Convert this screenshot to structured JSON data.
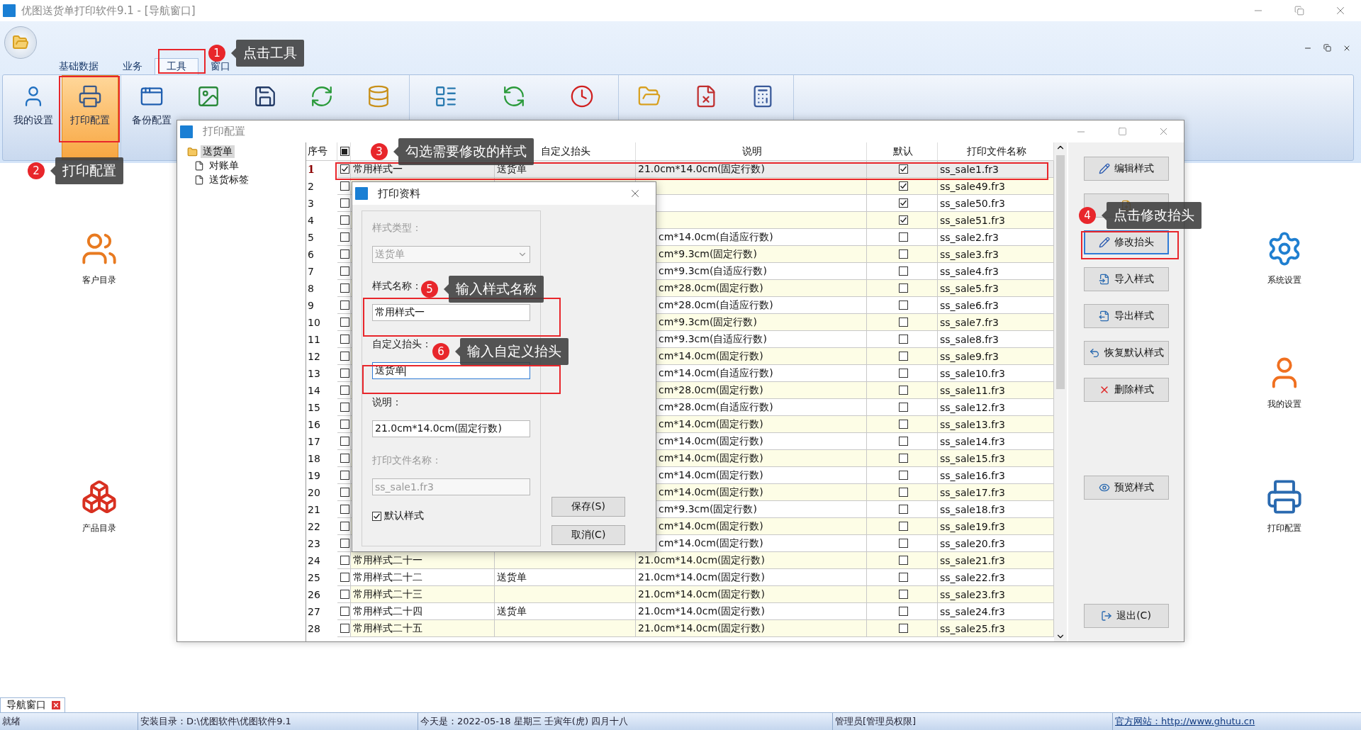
{
  "window": {
    "title": "优图送货单打印软件9.1 - [导航窗口]"
  },
  "ribbon": {
    "tabs": [
      {
        "label": "基础数据",
        "selected": false
      },
      {
        "label": "业务",
        "selected": false
      },
      {
        "label": "工具",
        "selected": true
      },
      {
        "label": "窗口",
        "selected": false
      }
    ],
    "toolbar_groups": [
      {
        "items": [
          {
            "label": "我的设置",
            "selected": false
          },
          {
            "label": "打印配置",
            "selected": true
          }
        ]
      },
      {
        "items": [
          {
            "label": "备份配置",
            "selected": false
          },
          {
            "selected": false
          },
          {
            "selected": false
          },
          {
            "selected": false
          },
          {
            "selected": false
          }
        ]
      },
      {
        "items": [
          {
            "selected": false
          },
          {
            "selected": false
          },
          {
            "selected": false
          }
        ]
      },
      {
        "items": [
          {
            "selected": false
          },
          {
            "selected": false
          },
          {
            "selected": false
          }
        ]
      }
    ]
  },
  "desktop_icons": [
    {
      "label": "客户目录"
    },
    {
      "label": "产品目录"
    },
    {
      "label": "系统设置"
    },
    {
      "label": "我的设置"
    },
    {
      "label": "打印配置"
    }
  ],
  "print_config": {
    "title": "打印配置",
    "tree": [
      {
        "label": "送货单",
        "selected": true,
        "kind": "folder"
      },
      {
        "label": "对账单",
        "selected": false,
        "kind": "document"
      },
      {
        "label": "送货标签",
        "selected": false,
        "kind": "document"
      }
    ],
    "table": {
      "header": {
        "number": "序号",
        "select_all_mixed": true,
        "custom_title": "自定义抬头",
        "description": "说明",
        "default": "默认",
        "file_name": "打印文件名称"
      },
      "rows": [
        {
          "no": "1",
          "checked": true,
          "selected": true,
          "covered": false,
          "name": "常用样式一",
          "custom_title": "送货单",
          "description": "21.0cm*14.0cm(固定行数)",
          "default": true,
          "file_name": "ss_sale1.fr3"
        },
        {
          "no": "2",
          "checked": false,
          "selected": false,
          "covered": true,
          "default": true,
          "file_name": "ss_sale49.fr3"
        },
        {
          "no": "3",
          "checked": false,
          "selected": false,
          "covered": true,
          "default": true,
          "file_name": "ss_sale50.fr3"
        },
        {
          "no": "4",
          "checked": false,
          "selected": false,
          "covered": true,
          "default": true,
          "file_name": "ss_sale51.fr3"
        },
        {
          "no": "5",
          "checked": false,
          "selected": false,
          "covered": true,
          "description": "cm*14.0cm(自适应行数)",
          "default": false,
          "file_name": "ss_sale2.fr3"
        },
        {
          "no": "6",
          "checked": false,
          "selected": false,
          "covered": true,
          "description": "cm*9.3cm(固定行数)",
          "default": false,
          "file_name": "ss_sale3.fr3"
        },
        {
          "no": "7",
          "checked": false,
          "selected": false,
          "covered": true,
          "description": "cm*9.3cm(自适应行数)",
          "default": false,
          "file_name": "ss_sale4.fr3"
        },
        {
          "no": "8",
          "checked": false,
          "selected": false,
          "covered": true,
          "description": "cm*28.0cm(固定行数)",
          "default": false,
          "file_name": "ss_sale5.fr3"
        },
        {
          "no": "9",
          "checked": false,
          "selected": false,
          "covered": true,
          "description": "cm*28.0cm(自适应行数)",
          "default": false,
          "file_name": "ss_sale6.fr3"
        },
        {
          "no": "10",
          "checked": false,
          "selected": false,
          "covered": true,
          "description": "cm*9.3cm(固定行数)",
          "default": false,
          "file_name": "ss_sale7.fr3"
        },
        {
          "no": "11",
          "checked": false,
          "selected": false,
          "covered": true,
          "description": "cm*9.3cm(自适应行数)",
          "default": false,
          "file_name": "ss_sale8.fr3"
        },
        {
          "no": "12",
          "checked": false,
          "selected": false,
          "covered": true,
          "description": "cm*14.0cm(固定行数)",
          "default": false,
          "file_name": "ss_sale9.fr3"
        },
        {
          "no": "13",
          "checked": false,
          "selected": false,
          "covered": true,
          "description": "cm*14.0cm(自适应行数)",
          "default": false,
          "file_name": "ss_sale10.fr3"
        },
        {
          "no": "14",
          "checked": false,
          "selected": false,
          "covered": true,
          "description": "cm*28.0cm(固定行数)",
          "default": false,
          "file_name": "ss_sale11.fr3"
        },
        {
          "no": "15",
          "checked": false,
          "selected": false,
          "covered": true,
          "description": "cm*28.0cm(自适应行数)",
          "default": false,
          "file_name": "ss_sale12.fr3"
        },
        {
          "no": "16",
          "checked": false,
          "selected": false,
          "covered": true,
          "description": "cm*14.0cm(固定行数)",
          "default": false,
          "file_name": "ss_sale13.fr3"
        },
        {
          "no": "17",
          "checked": false,
          "selected": false,
          "covered": true,
          "description": "cm*14.0cm(固定行数)",
          "default": false,
          "file_name": "ss_sale14.fr3"
        },
        {
          "no": "18",
          "checked": false,
          "selected": false,
          "covered": true,
          "description": "cm*14.0cm(固定行数)",
          "default": false,
          "file_name": "ss_sale15.fr3"
        },
        {
          "no": "19",
          "checked": false,
          "selected": false,
          "covered": true,
          "description": "cm*14.0cm(固定行数)",
          "default": false,
          "file_name": "ss_sale16.fr3"
        },
        {
          "no": "20",
          "checked": false,
          "selected": false,
          "covered": true,
          "description": "cm*14.0cm(固定行数)",
          "default": false,
          "file_name": "ss_sale17.fr3"
        },
        {
          "no": "21",
          "checked": false,
          "selected": false,
          "covered": true,
          "description": "cm*9.3cm(固定行数)",
          "default": false,
          "file_name": "ss_sale18.fr3"
        },
        {
          "no": "22",
          "checked": false,
          "selected": false,
          "covered": true,
          "description": "cm*14.0cm(固定行数)",
          "default": false,
          "file_name": "ss_sale19.fr3"
        },
        {
          "no": "23",
          "checked": false,
          "selected": false,
          "covered": true,
          "description": "cm*14.0cm(固定行数)",
          "default": false,
          "file_name": "ss_sale20.fr3"
        },
        {
          "no": "24",
          "checked": false,
          "selected": false,
          "covered": false,
          "name": "常用样式二十一",
          "description": "21.0cm*14.0cm(固定行数)",
          "default": false,
          "file_name": "ss_sale21.fr3"
        },
        {
          "no": "25",
          "checked": false,
          "selected": false,
          "covered": false,
          "name": "常用样式二十二",
          "custom_title": "送货单",
          "description": "21.0cm*14.0cm(固定行数)",
          "default": false,
          "file_name": "ss_sale22.fr3"
        },
        {
          "no": "26",
          "checked": false,
          "selected": false,
          "covered": false,
          "name": "常用样式二十三",
          "description": "21.0cm*14.0cm(固定行数)",
          "default": false,
          "file_name": "ss_sale23.fr3"
        },
        {
          "no": "27",
          "checked": false,
          "selected": false,
          "covered": false,
          "name": "常用样式二十四",
          "custom_title": "送货单",
          "description": "21.0cm*14.0cm(固定行数)",
          "default": false,
          "file_name": "ss_sale24.fr3"
        },
        {
          "no": "28",
          "checked": false,
          "selected": false,
          "covered": false,
          "name": "常用样式二十五",
          "description": "21.0cm*14.0cm(固定行数)",
          "default": false,
          "file_name": "ss_sale25.fr3"
        }
      ]
    },
    "button_groups": [
      [
        {
          "label": "编辑样式",
          "selected": false
        },
        {
          "selected": false
        },
        {
          "label": "修改抬头",
          "selected": true
        },
        {
          "label": "导入样式",
          "selected": false
        },
        {
          "label": "导出样式",
          "selected": false
        },
        {
          "label": "恢复默认样式",
          "selected": false
        },
        {
          "label": "删除样式",
          "selected": false
        }
      ],
      [
        {
          "label": "预览样式",
          "selected": false
        }
      ],
      [
        {
          "label": "退出(C)",
          "selected": false
        }
      ]
    ]
  },
  "dialog": {
    "title": "打印资料",
    "fields": [
      {
        "label": "样式类型：",
        "kind": "select",
        "value": "送货单",
        "disabled": true,
        "focused": false
      },
      {
        "label": "样式名称：",
        "kind": "text",
        "value": "常用样式一",
        "disabled": false,
        "focused": false
      },
      {
        "label": "自定义抬头：",
        "kind": "text",
        "value": "送货单",
        "disabled": false,
        "focused": true
      },
      {
        "label": "说明：",
        "kind": "text",
        "value": "21.0cm*14.0cm(固定行数)",
        "disabled": false,
        "focused": false
      },
      {
        "label": "打印文件名称：",
        "kind": "text",
        "value": "ss_sale1.fr3",
        "disabled": true,
        "focused": false
      }
    ],
    "checkbox": {
      "label": "默认样式",
      "checked": true
    },
    "buttons": [
      "保存(S)",
      "取消(C)"
    ]
  },
  "callouts": [
    {
      "number": "1",
      "text": "点击工具"
    },
    {
      "number": "2",
      "text": "打印配置"
    },
    {
      "number": "3",
      "text": "勾选需要修改的样式"
    },
    {
      "number": "4",
      "text": "点击修改抬头"
    },
    {
      "number": "5",
      "text": "输入样式名称"
    },
    {
      "number": "6",
      "text": "输入自定义抬头"
    }
  ],
  "nav_tab": {
    "label": "导航窗口"
  },
  "status_bar": [
    "就绪",
    "安装目录：D:\\优图软件\\优图软件9.1",
    "今天是：2022-05-18 星期三 壬寅年(虎) 四月十八",
    "管理员[管理员权限]",
    "官方网站：http://www.ghutu.cn"
  ]
}
